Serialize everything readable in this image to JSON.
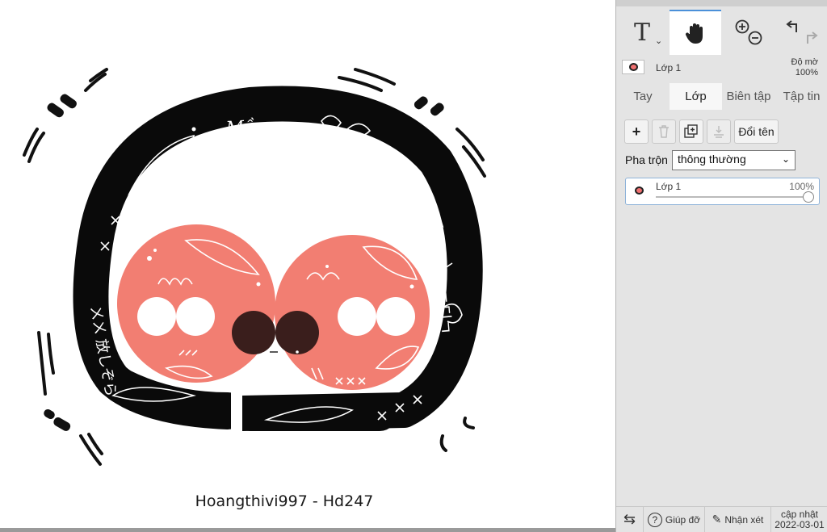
{
  "canvas": {
    "watermark_text": "Hoangthivi997 - Hd247",
    "handwriting_top": "Mầm",
    "handwriting_left": "ㄨㄨ 放しぞら",
    "handwriting_right": "ㄷ디",
    "colors": {
      "ring": "#0a0a0a",
      "cheek": "#f27e72",
      "eye": "#ffffff",
      "nose": "#3a1e1c"
    }
  },
  "toolbar": {
    "tools": [
      {
        "name": "text-tool",
        "icon": "text-icon"
      },
      {
        "name": "hand-tool",
        "icon": "hand-icon",
        "active": true
      },
      {
        "name": "zoom-tool",
        "icon": "zoom-icon"
      },
      {
        "name": "undo-redo",
        "icon": "undo-icon"
      }
    ]
  },
  "layer_header": {
    "layer_name": "Lớp 1",
    "opacity_label": "Độ mờ",
    "opacity_value": "100%"
  },
  "tabs": [
    {
      "label": "Tay",
      "active": false
    },
    {
      "label": "Lớp",
      "active": true
    },
    {
      "label": "Biên tập",
      "active": false
    },
    {
      "label": "Tập tin",
      "active": false
    }
  ],
  "layers_panel": {
    "rename_button": "Đổi tên",
    "blend_label": "Pha trộn",
    "blend_value": "thông thường",
    "layer": {
      "name": "Lớp 1",
      "opacity": "100%"
    }
  },
  "bottom_bar": {
    "help_label": "Giúp đỡ",
    "feedback_label": "Nhận xét",
    "update_label": "cập nhật",
    "update_date": "2022-03-01"
  }
}
